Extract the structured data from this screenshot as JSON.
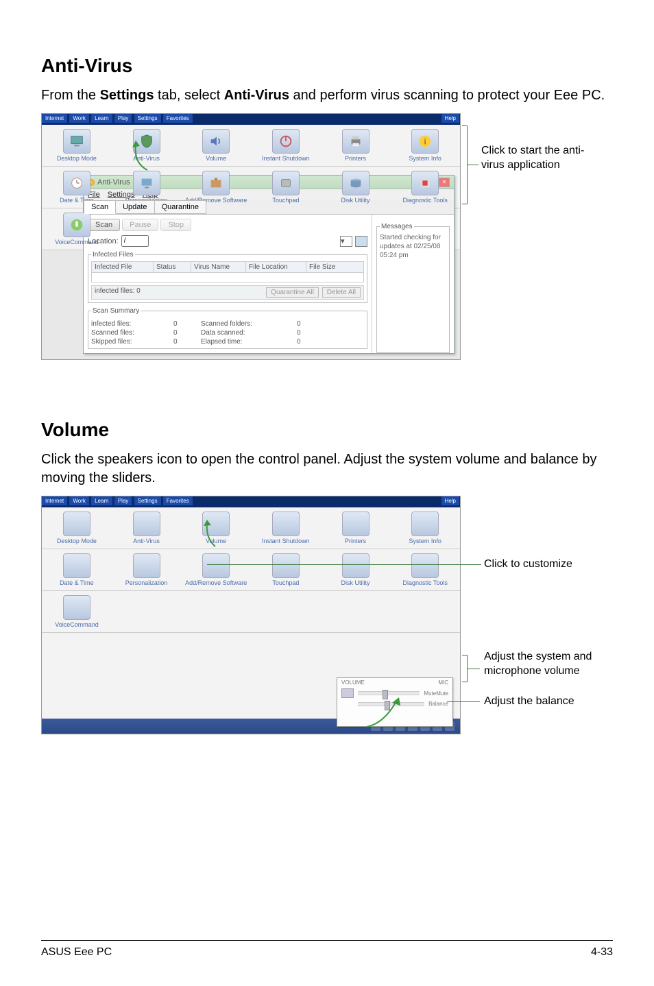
{
  "section1": {
    "heading": "Anti-Virus",
    "intro_pre": "From the ",
    "intro_b1": "Settings",
    "intro_mid": " tab, select ",
    "intro_b2": "Anti-Virus",
    "intro_post": " and perform virus scanning to protect your Eee PC.",
    "callout": "Click to start the anti-virus application"
  },
  "topbar": {
    "tabs_left": [
      "Internet",
      "Work",
      "Learn",
      "Play",
      "Settings",
      "Favorites"
    ],
    "help": "Help"
  },
  "launcher_row1": {
    "items": [
      {
        "label": "Desktop Mode"
      },
      {
        "label": "Anti-Virus"
      },
      {
        "label": "Volume"
      },
      {
        "label": "Instant Shutdown"
      },
      {
        "label": "Printers"
      },
      {
        "label": "System Info"
      }
    ]
  },
  "launcher_row2": {
    "items": [
      {
        "label": "Date & Time"
      },
      {
        "label": "Personalization"
      },
      {
        "label": "Add/Remove Software"
      },
      {
        "label": "Touchpad"
      },
      {
        "label": "Disk Utility"
      },
      {
        "label": "Diagnostic Tools"
      }
    ]
  },
  "launcher_row3": {
    "item": {
      "label": "VoiceCommand"
    }
  },
  "av": {
    "title": "Anti-Virus",
    "menu": {
      "file": "File",
      "settings": "Settings",
      "help": "Help"
    },
    "tabs": {
      "scan": "Scan",
      "update": "Update",
      "quarantine": "Quarantine"
    },
    "scan_btn": "Scan",
    "pause_btn": "Pause",
    "stop_btn": "Stop",
    "location_label": "Location:",
    "location_value": "/",
    "infected_legend": "Infected Files",
    "cols": {
      "file": "Infected File",
      "status": "Status",
      "vname": "Virus Name",
      "floc": "File Location",
      "fsize": "File Size"
    },
    "inf_label": "infected files:",
    "inf_count": "0",
    "quar_all": "Quarantine All",
    "del_all": "Delete All",
    "summary_legend": "Scan Summary",
    "sum": {
      "infected": "infected files:",
      "infected_v": "0",
      "scannedf": "Scanned folders:",
      "scannedf_v": "0",
      "scanned": "Scanned files:",
      "scanned_v": "0",
      "datasc": "Data scanned:",
      "datasc_v": "0",
      "skipped": "Skipped files:",
      "skipped_v": "0",
      "elapsed": "Elapsed time:",
      "elapsed_v": "0"
    },
    "messages_legend": "Messages",
    "msg": "Started checking for updates at 02/25/08 05:24 pm"
  },
  "section2": {
    "heading": "Volume",
    "intro": "Click the speakers icon to open the control panel. Adjust the system volume and balance by moving the sliders.",
    "callout1": "Click to customize",
    "callout2": "Adjust the system and microphone volume",
    "callout3": "Adjust the balance"
  },
  "vol_popup": {
    "vol_label_l": "VOLUME",
    "vol_label_r": "MIC",
    "mute_l": "Mute",
    "mute_r": "Mute",
    "balance": "Balance"
  },
  "footer": {
    "left": "ASUS Eee PC",
    "right": "4-33"
  }
}
